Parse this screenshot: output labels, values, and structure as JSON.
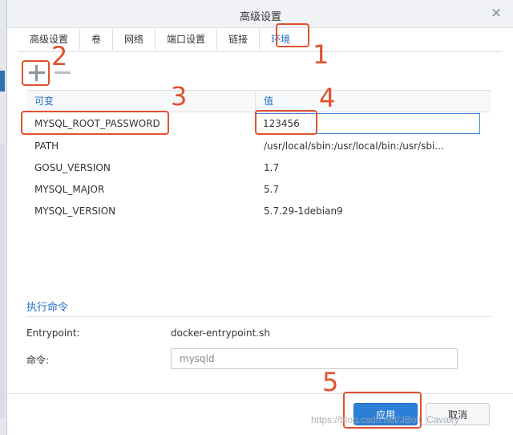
{
  "dialog": {
    "title": "高级设置",
    "close_icon": "close-icon"
  },
  "tabs": [
    {
      "label": "高级设置",
      "active": false
    },
    {
      "label": "卷",
      "active": false
    },
    {
      "label": "网络",
      "active": false
    },
    {
      "label": "端口设置",
      "active": false
    },
    {
      "label": "链接",
      "active": false
    },
    {
      "label": "环境",
      "active": true
    }
  ],
  "toolbar": {
    "add_icon": "plus-icon",
    "remove_icon": "minus-icon"
  },
  "env_table": {
    "headers": {
      "variable": "可变",
      "value": "值"
    },
    "rows": [
      {
        "name": "MYSQL_ROOT_PASSWORD",
        "value": "123456"
      },
      {
        "name": "PATH",
        "value": "/usr/local/sbin:/usr/local/bin:/usr/sbi..."
      },
      {
        "name": "GOSU_VERSION",
        "value": "1.7"
      },
      {
        "name": "MYSQL_MAJOR",
        "value": "5.7"
      },
      {
        "name": "MYSQL_VERSION",
        "value": "5.7.29-1debian9"
      }
    ]
  },
  "exec": {
    "section_title": "执行命令",
    "entrypoint_label": "Entrypoint:",
    "entrypoint_value": "docker-entrypoint.sh",
    "command_label": "命令:",
    "command_value": "mysqld"
  },
  "footer": {
    "apply_label": "应用",
    "cancel_label": "取消"
  },
  "annotations": {
    "n1": "1",
    "n2": "2",
    "n3": "3",
    "n4": "4",
    "n5": "5",
    "color": "#e0522d"
  },
  "colors": {
    "accent": "#1f6fc5",
    "apply_button": "#2c7fd6"
  },
  "watermark": "https://blog.csdn.net/JBolt_Cavalry"
}
